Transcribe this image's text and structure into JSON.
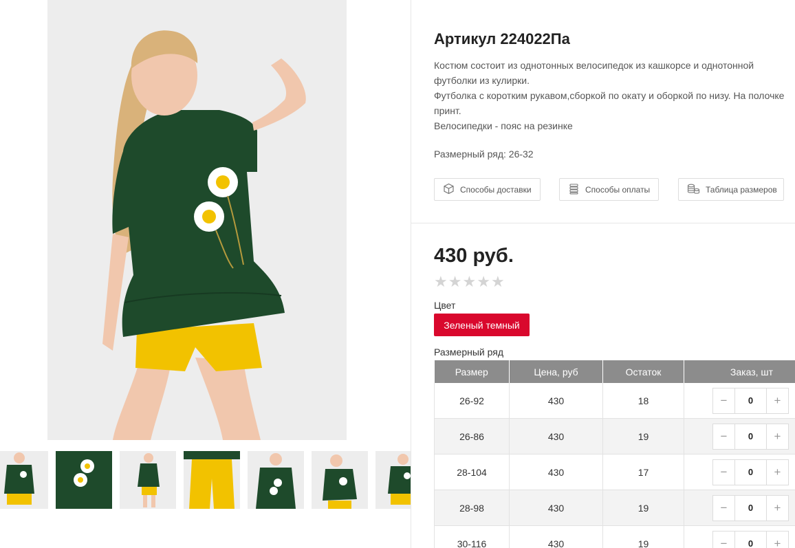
{
  "product": {
    "title": "Артикул 224022Па",
    "description": [
      "Костюм состоит из однотонных велосипедок из кашкорсе и однотонной",
      "футболки из кулирки.",
      "Футболка  с коротким рукавом,сборкой по окату и оборкой по низу. На полочке",
      "принт.",
      "Велосипедки - пояс на резинке"
    ],
    "size_range_text": "Размерный ряд: 26-32"
  },
  "info_buttons": {
    "delivery": "Способы доставки",
    "payment": "Способы оплаты",
    "size_table": "Таблица размеров"
  },
  "price": "430 руб.",
  "rating": {
    "stars_total": 5,
    "stars_filled": 0,
    "star_glyph": "★"
  },
  "color": {
    "label": "Цвет",
    "selected": "Зеленый темный",
    "accent": "#d9082d"
  },
  "sizes_table": {
    "label": "Размерный ряд",
    "headers": [
      "Размер",
      "Цена, руб",
      "Остаток",
      "Заказ, шт"
    ],
    "rows": [
      {
        "size": "26-92",
        "price": "430",
        "stock": "18",
        "qty": "0"
      },
      {
        "size": "26-86",
        "price": "430",
        "stock": "19",
        "qty": "0"
      },
      {
        "size": "28-104",
        "price": "430",
        "stock": "17",
        "qty": "0"
      },
      {
        "size": "28-98",
        "price": "430",
        "stock": "19",
        "qty": "0"
      },
      {
        "size": "30-116",
        "price": "430",
        "stock": "19",
        "qty": "0"
      }
    ],
    "minus": "−",
    "plus": "+"
  },
  "gallery": {
    "thumbnail_count": 7,
    "colors": {
      "shirt": "#1e4a2b",
      "shorts": "#f2c200",
      "background": "#ededed",
      "skin": "#f1c7ad",
      "hair": "#d9b27a"
    }
  }
}
